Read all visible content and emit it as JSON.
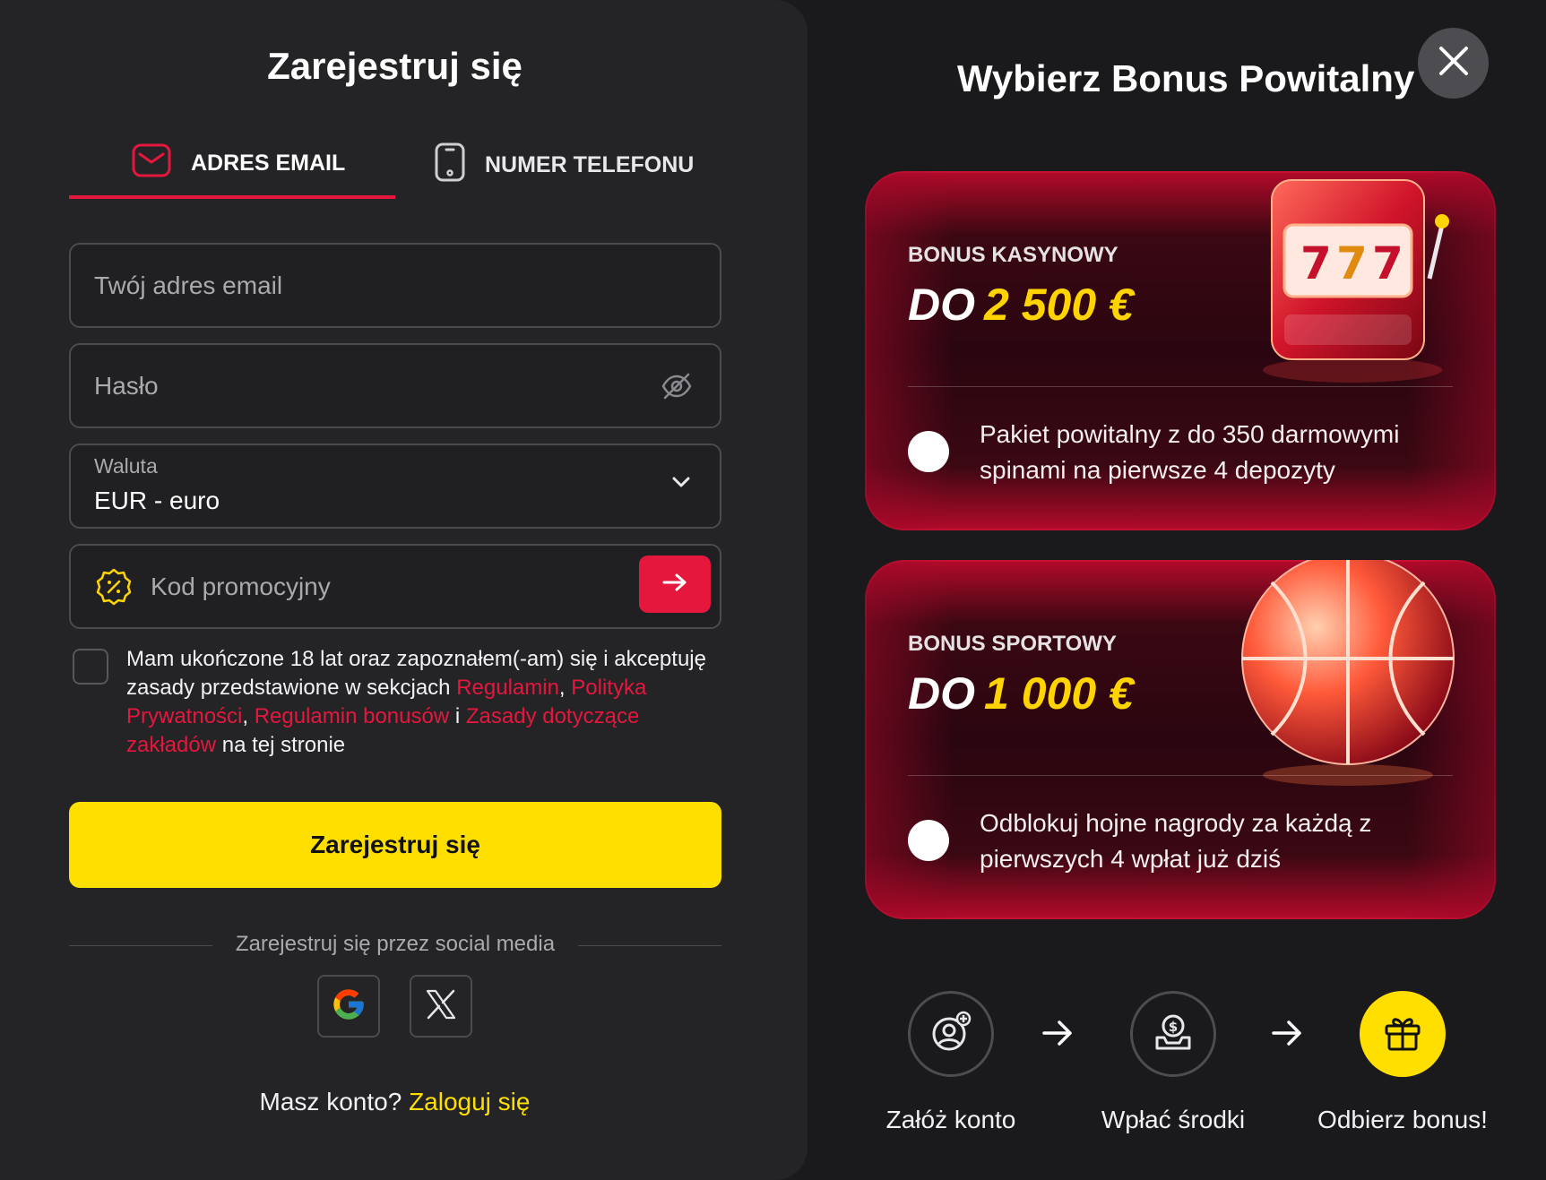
{
  "register": {
    "title": "Zarejestruj się",
    "tabs": [
      {
        "label": "ADRES EMAIL",
        "icon": "envelope-icon",
        "active": true
      },
      {
        "label": "NUMER TELEFONU",
        "icon": "phone-icon",
        "active": false
      }
    ],
    "email_placeholder": "Twój adres email",
    "password_placeholder": "Hasło",
    "currency": {
      "label": "Waluta",
      "value": "EUR - euro"
    },
    "promo_placeholder": "Kod promocyjny",
    "terms": {
      "t1": "Mam ukończone 18 lat oraz zapoznałem(-am) się i akceptuję zasady przedstawione w sekcjach ",
      "l1": "Regulamin",
      "t2": ", ",
      "l2": "Polityka Prywatności",
      "t3": ", ",
      "l3": "Regulamin bonusów",
      "t4": " i ",
      "l4": "Zasady dotyczące zakładów",
      "t5": " na tej stronie"
    },
    "submit_label": "Zarejestruj się",
    "social_label": "Zarejestruj się przez social media",
    "login_prompt": "Masz konto?",
    "login_link": "Zaloguj się"
  },
  "bonus": {
    "title": "Wybierz Bonus Powitalny",
    "cards": [
      {
        "kind": "BONUS KASYNOWY",
        "do": "DO",
        "amount": "2 500 €",
        "desc": "Pakiet powitalny z do 350 darmowymi spinami na pierwsze 4 depozyty",
        "art": "slot-machine-icon"
      },
      {
        "kind": "BONUS SPORTOWY",
        "do": "DO",
        "amount": "1 000 €",
        "desc": "Odblokuj hojne nagrody za każdą z pierwszych 4 wpłat już dziś",
        "art": "basketball-icon"
      }
    ],
    "steps": [
      {
        "label": "Załóż konto",
        "icon": "add-user-icon"
      },
      {
        "label": "Wpłać środki",
        "icon": "deposit-icon"
      },
      {
        "label": "Odbierz bonus!",
        "icon": "gift-icon"
      }
    ]
  },
  "colors": {
    "accent_red": "#e5173d",
    "accent_yellow": "#ffdf00",
    "background": "#1a1a1c",
    "panel": "#242427"
  }
}
